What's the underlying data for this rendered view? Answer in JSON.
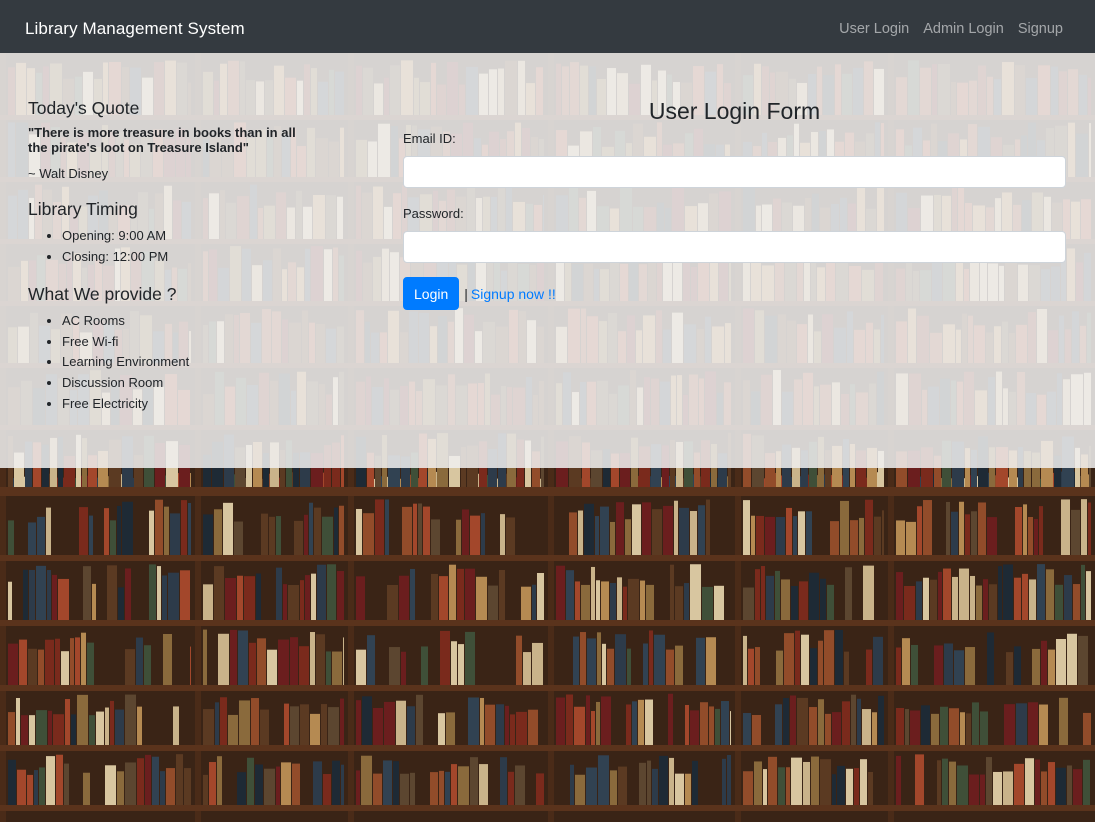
{
  "navbar": {
    "brand": "Library Management System",
    "links": [
      "User Login",
      "Admin Login",
      "Signup"
    ]
  },
  "sidebar": {
    "quote_heading": "Today's Quote",
    "quote_text": "\"There is more treasure in books than in all the pirate's loot on Treasure Island\"",
    "quote_author": "~ Walt Disney",
    "timing_heading": "Library Timing",
    "timings": [
      "Opening: 9:00 AM",
      "Closing: 12:00 PM"
    ],
    "provide_heading": "What We provide ?",
    "provides": [
      "AC Rooms",
      "Free Wi-fi",
      "Learning Environment",
      "Discussion Room",
      "Free Electricity"
    ]
  },
  "login_form": {
    "title": "User Login Form",
    "email_label": "Email ID:",
    "email_value": "",
    "password_label": "Password:",
    "password_value": "",
    "login_label": "Login",
    "separator": "|",
    "signup_link": "Signup now !!"
  },
  "colors": {
    "navbar_bg": "#343a40",
    "primary": "#007bff",
    "panel_overlay": "#f0f0f0"
  }
}
